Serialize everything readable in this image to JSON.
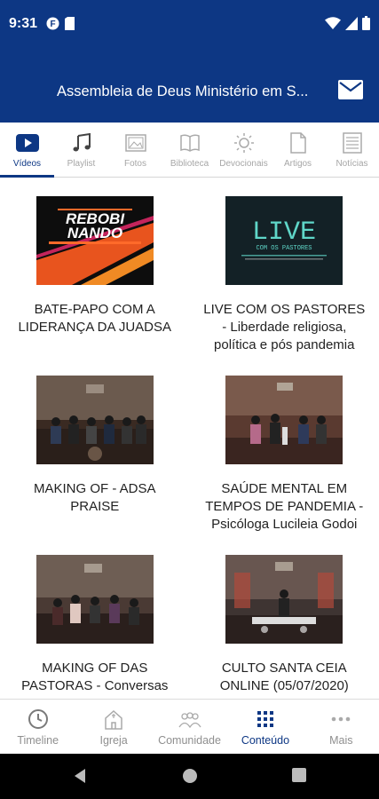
{
  "status_bar": {
    "time": "9:31",
    "icons": [
      "app-notification-icon",
      "sim-card-icon",
      "wifi-icon",
      "signal-icon",
      "battery-icon"
    ]
  },
  "app_bar": {
    "title": "Assembleia de Deus Ministério em S...",
    "mail_icon": "mail-icon"
  },
  "tabs": [
    {
      "label": "Vídeos",
      "icon": "video-icon",
      "active": true
    },
    {
      "label": "Playlist",
      "icon": "music-note-icon",
      "active": false
    },
    {
      "label": "Fotos",
      "icon": "photo-icon",
      "active": false
    },
    {
      "label": "Biblioteca",
      "icon": "book-icon",
      "active": false
    },
    {
      "label": "Devocionais",
      "icon": "sun-icon",
      "active": false
    },
    {
      "label": "Artigos",
      "icon": "document-icon",
      "active": false
    },
    {
      "label": "Notícias",
      "icon": "newspaper-icon",
      "active": false
    }
  ],
  "videos": [
    {
      "title": "BATE-PAPO COM A LIDERANÇA DA JUADSA",
      "thumb_text": [
        "REBOBI",
        "NANDO"
      ]
    },
    {
      "title": "LIVE COM OS PASTORES - Liberdade religiosa, política e pós pandemia",
      "thumb_text": [
        "LIVE",
        "COM OS PASTORES"
      ]
    },
    {
      "title": "MAKING OF - ADSA PRAISE"
    },
    {
      "title": "SAÚDE MENTAL EM TEMPOS DE PANDEMIA - Psicóloga Lucileia Godoi"
    },
    {
      "title": "MAKING OF DAS PASTORAS - Conversas com nossos pastores"
    },
    {
      "title": "CULTO SANTA CEIA ONLINE (05/07/2020)"
    }
  ],
  "bottom_nav": [
    {
      "label": "Timeline",
      "icon": "clock-icon",
      "active": false
    },
    {
      "label": "Igreja",
      "icon": "church-icon",
      "active": false
    },
    {
      "label": "Comunidade",
      "icon": "community-icon",
      "active": false
    },
    {
      "label": "Conteúdo",
      "icon": "grid-icon",
      "active": true
    },
    {
      "label": "Mais",
      "icon": "more-dots-icon",
      "active": false
    }
  ],
  "system_nav": [
    "back-icon",
    "home-icon",
    "recents-icon"
  ],
  "colors": {
    "brand": "#0d3784",
    "inactive": "#a6a6a6",
    "text": "#222222"
  }
}
